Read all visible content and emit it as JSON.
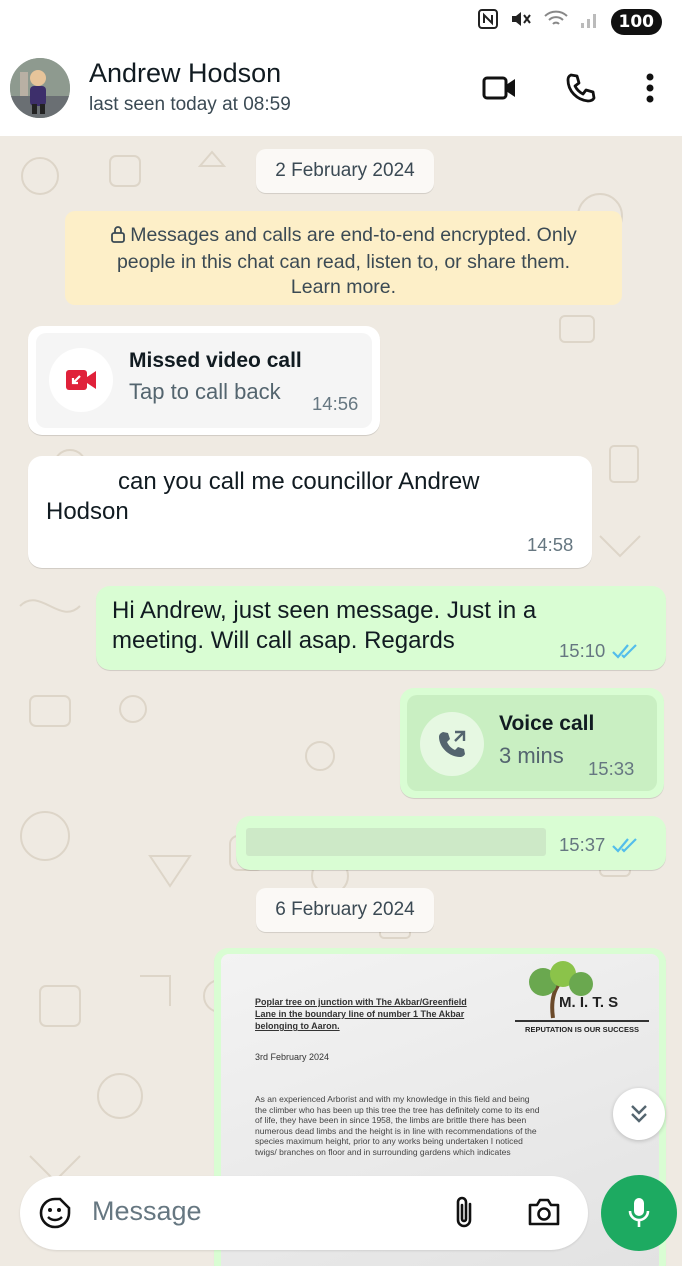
{
  "status_bar": {
    "battery": "100"
  },
  "header": {
    "contact_name": "Andrew Hodson",
    "last_seen": "last seen today at 08:59"
  },
  "chat": {
    "date_1": "2 February 2024",
    "encryption_notice": {
      "line1": "Messages and calls are end-to-end encrypted. Only",
      "line2": "people in this chat can read, listen to, or share them.",
      "line3": "Learn more."
    },
    "missed_call": {
      "title": "Missed video call",
      "subtitle": "Tap to call back",
      "time": "14:56"
    },
    "msg_incoming": {
      "line1": "can you call me councillor Andrew",
      "line2": "Hodson",
      "time": "14:58"
    },
    "msg_outgoing": {
      "line1": "Hi Andrew, just seen message. Just in a",
      "line2": "meeting. Will call asap. Regards",
      "time": "15:10"
    },
    "voice_call": {
      "title": "Voice call",
      "subtitle": "3 mins",
      "time": "15:33"
    },
    "redacted_msg": {
      "time": "15:37"
    },
    "date_2": "6 February 2024",
    "document": {
      "heading_line1": "Poplar tree on junction with The Akbar/Greenfield",
      "heading_line2": "Lane in the boundary line of number 1 The Akbar",
      "heading_line3": "belonging to Aaron.",
      "logo_name": "M. I. T. S",
      "logo_tagline": "REPUTATION IS OUR SUCCESS",
      "date": "3rd February 2024",
      "body": [
        "As an experienced Arborist and with my knowledge in this field and being",
        "the climber who has been up this tree the tree has definitely come to its end",
        "of life, they have been in since 1958, the limbs are brittle there has been",
        "numerous dead limbs and the height is in line with recommendations of the",
        "species maximum height, prior to any works being undertaken I noticed",
        "twigs/ branches on floor and in surrounding gardens which indicates"
      ]
    }
  },
  "input": {
    "placeholder": "Message"
  },
  "colors": {
    "accent": "#1daa61",
    "outgoing": "#d9fdd3",
    "tick": "#53bdeb",
    "missed": "#e0213a"
  }
}
